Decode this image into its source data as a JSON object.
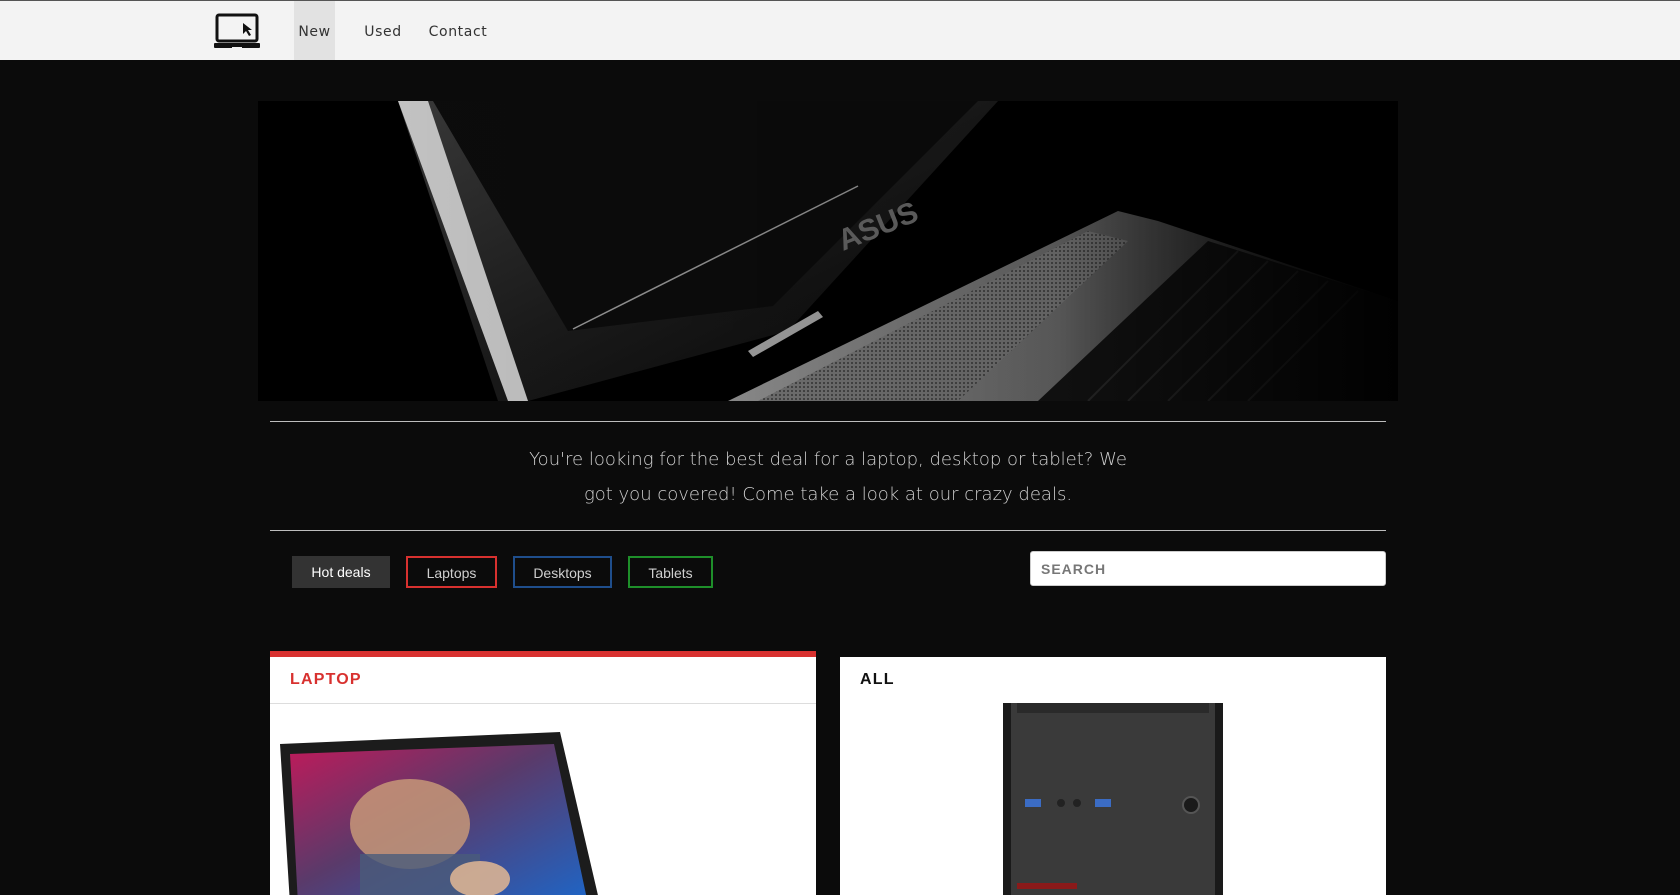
{
  "nav": {
    "logo_icon": "laptop-cursor-icon",
    "items": [
      {
        "label": "New",
        "active": true
      },
      {
        "label": "Used",
        "active": false
      },
      {
        "label": "Contact",
        "active": false
      }
    ]
  },
  "hero": {
    "image": "laptop-closeup-image"
  },
  "tagline": "You're looking for the best deal for a laptop, desktop or tablet? We got you covered! Come take a look at our crazy deals.",
  "filters": [
    {
      "label": "Hot deals",
      "color": "#333333"
    },
    {
      "label": "Laptops",
      "color": "#d8312f"
    },
    {
      "label": "Desktops",
      "color": "#1f4e8c"
    },
    {
      "label": "Tablets",
      "color": "#1e8f2a"
    }
  ],
  "search": {
    "placeholder": "SEARCH",
    "value": ""
  },
  "cards": [
    {
      "title": "LAPTOP",
      "accent": "#d8312f",
      "image": "laptop-product-image"
    },
    {
      "title": "ALL",
      "accent": "#111111",
      "image": "desktop-tower-image"
    }
  ]
}
